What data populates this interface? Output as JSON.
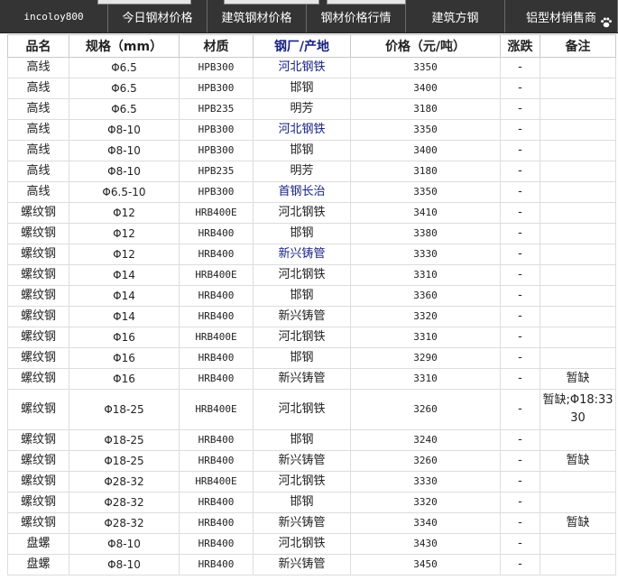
{
  "nav": {
    "items": [
      "incoloy800",
      "今日钢材价格",
      "建筑钢材价格",
      "钢材价格行情",
      "建筑方钢",
      "铝型材销售商"
    ]
  },
  "table": {
    "headers": [
      "品名",
      "规格（mm）",
      "材质",
      "钢厂/产地",
      "价格（元/吨）",
      "涨跌",
      "备注"
    ],
    "rows": [
      {
        "name": "高线",
        "spec": "Φ6.5",
        "grade": "HPB300",
        "mill": "河北钢铁",
        "mill_link": true,
        "price": "3350",
        "change": "-",
        "note": ""
      },
      {
        "name": "高线",
        "spec": "Φ6.5",
        "grade": "HPB300",
        "mill": "邯钢",
        "mill_link": false,
        "price": "3400",
        "change": "-",
        "note": ""
      },
      {
        "name": "高线",
        "spec": "Φ6.5",
        "grade": "HPB235",
        "mill": "明芳",
        "mill_link": false,
        "price": "3180",
        "change": "-",
        "note": ""
      },
      {
        "name": "高线",
        "spec": "Φ8-10",
        "grade": "HPB300",
        "mill": "河北钢铁",
        "mill_link": true,
        "price": "3350",
        "change": "-",
        "note": ""
      },
      {
        "name": "高线",
        "spec": "Φ8-10",
        "grade": "HPB300",
        "mill": "邯钢",
        "mill_link": false,
        "price": "3400",
        "change": "-",
        "note": ""
      },
      {
        "name": "高线",
        "spec": "Φ8-10",
        "grade": "HPB235",
        "mill": "明芳",
        "mill_link": false,
        "price": "3180",
        "change": "-",
        "note": ""
      },
      {
        "name": "高线",
        "spec": "Φ6.5-10",
        "grade": "HPB300",
        "mill": "首钢长治",
        "mill_link": true,
        "price": "3350",
        "change": "-",
        "note": ""
      },
      {
        "name": "螺纹钢",
        "spec": "Φ12",
        "grade": "HRB400E",
        "mill": "河北钢铁",
        "mill_link": false,
        "price": "3410",
        "change": "-",
        "note": ""
      },
      {
        "name": "螺纹钢",
        "spec": "Φ12",
        "grade": "HRB400",
        "mill": "邯钢",
        "mill_link": false,
        "price": "3380",
        "change": "-",
        "note": ""
      },
      {
        "name": "螺纹钢",
        "spec": "Φ12",
        "grade": "HRB400",
        "mill": "新兴铸管",
        "mill_link": true,
        "price": "3330",
        "change": "-",
        "note": ""
      },
      {
        "name": "螺纹钢",
        "spec": "Φ14",
        "grade": "HRB400E",
        "mill": "河北钢铁",
        "mill_link": false,
        "price": "3310",
        "change": "-",
        "note": ""
      },
      {
        "name": "螺纹钢",
        "spec": "Φ14",
        "grade": "HRB400",
        "mill": "邯钢",
        "mill_link": false,
        "price": "3360",
        "change": "-",
        "note": ""
      },
      {
        "name": "螺纹钢",
        "spec": "Φ14",
        "grade": "HRB400",
        "mill": "新兴铸管",
        "mill_link": false,
        "price": "3320",
        "change": "-",
        "note": ""
      },
      {
        "name": "螺纹钢",
        "spec": "Φ16",
        "grade": "HRB400E",
        "mill": "河北钢铁",
        "mill_link": false,
        "price": "3310",
        "change": "-",
        "note": ""
      },
      {
        "name": "螺纹钢",
        "spec": "Φ16",
        "grade": "HRB400",
        "mill": "邯钢",
        "mill_link": false,
        "price": "3290",
        "change": "-",
        "note": ""
      },
      {
        "name": "螺纹钢",
        "spec": "Φ16",
        "grade": "HRB400",
        "mill": "新兴铸管",
        "mill_link": false,
        "price": "3310",
        "change": "-",
        "note": "暂缺"
      },
      {
        "name": "螺纹钢",
        "spec": "Φ18-25",
        "grade": "HRB400E",
        "mill": "河北钢铁",
        "mill_link": false,
        "price": "3260",
        "change": "-",
        "note": "暂缺;Φ18:3330",
        "tall": true
      },
      {
        "name": "螺纹钢",
        "spec": "Φ18-25",
        "grade": "HRB400",
        "mill": "邯钢",
        "mill_link": false,
        "price": "3240",
        "change": "-",
        "note": ""
      },
      {
        "name": "螺纹钢",
        "spec": "Φ18-25",
        "grade": "HRB400",
        "mill": "新兴铸管",
        "mill_link": false,
        "price": "3260",
        "change": "-",
        "note": "暂缺"
      },
      {
        "name": "螺纹钢",
        "spec": "Φ28-32",
        "grade": "HRB400E",
        "mill": "河北钢铁",
        "mill_link": false,
        "price": "3330",
        "change": "-",
        "note": ""
      },
      {
        "name": "螺纹钢",
        "spec": "Φ28-32",
        "grade": "HRB400",
        "mill": "邯钢",
        "mill_link": false,
        "price": "3320",
        "change": "-",
        "note": ""
      },
      {
        "name": "螺纹钢",
        "spec": "Φ28-32",
        "grade": "HRB400",
        "mill": "新兴铸管",
        "mill_link": false,
        "price": "3340",
        "change": "-",
        "note": "暂缺"
      },
      {
        "name": "盘螺",
        "spec": "Φ8-10",
        "grade": "HRB400",
        "mill": "河北钢铁",
        "mill_link": false,
        "price": "3430",
        "change": "-",
        "note": ""
      },
      {
        "name": "盘螺",
        "spec": "Φ8-10",
        "grade": "HRB400",
        "mill": "新兴铸管",
        "mill_link": false,
        "price": "3450",
        "change": "-",
        "note": ""
      }
    ]
  }
}
